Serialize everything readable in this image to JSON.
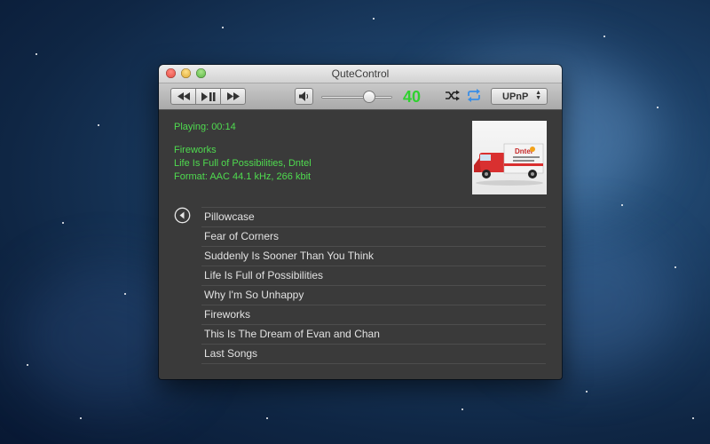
{
  "window": {
    "title": "QuteControl"
  },
  "toolbar": {
    "rewind_icon": "rewind-icon",
    "play_pause_icon": "play-pause-icon",
    "fast_forward_icon": "fast-forward-icon",
    "volume_icon": "speaker-icon",
    "volume_level": 0.67,
    "volume_value": "40",
    "shuffle_icon": "shuffle-icon",
    "repeat_icon": "repeat-icon",
    "source_select": "UPnP"
  },
  "now_playing": {
    "status": "Playing: 00:14",
    "track": "Fireworks",
    "album": "Life Is Full of Possibilities, Dntel",
    "format": "Format: AAC 44.1 kHz, 266 kbit",
    "album_art_text": "Dntel"
  },
  "playlist": {
    "back_icon": "back-arrow-icon",
    "tracks": [
      "Pillowcase",
      "Fear of Corners",
      "Suddenly Is Sooner Than You Think",
      "Life Is Full of Possibilities",
      "Why I'm So Unhappy",
      "Fireworks",
      "This Is The Dream of Evan and Chan",
      "Last Songs"
    ]
  },
  "colors": {
    "accent_green": "#4fdb4f",
    "volume_green": "#2fd12f",
    "repeat_blue": "#3a8ee6",
    "window_bg": "#3a3a3a"
  }
}
